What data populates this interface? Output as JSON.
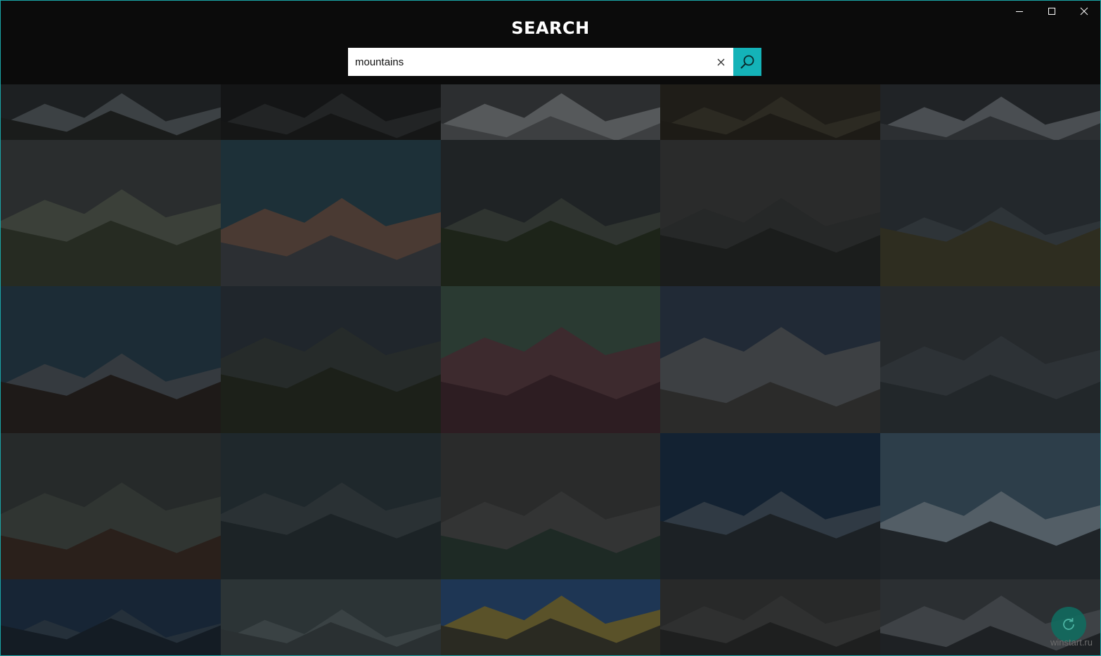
{
  "app": {
    "title": "SEARCH"
  },
  "window_controls": [
    "minimize-icon",
    "maximize-icon",
    "close-icon"
  ],
  "search": {
    "value": "mountains",
    "clear_icon": "close-icon",
    "button_icon": "search-icon"
  },
  "colors": {
    "accent": "#14b3b8",
    "background": "#0b0b0b",
    "border": "#1aa6a8",
    "fab": "#0f6e61"
  },
  "results": {
    "tiles": [
      {
        "sky": "#1d2022",
        "far": "#3c4144",
        "near": "#1a1c1b"
      },
      {
        "sky": "#141516",
        "far": "#222425",
        "near": "#151616"
      },
      {
        "sky": "#2c2e30",
        "far": "#56595b",
        "near": "#3d3f41"
      },
      {
        "sky": "#1f1d18",
        "far": "#2c2a22",
        "near": "#1d1b16"
      },
      {
        "sky": "#202326",
        "far": "#4a4e52",
        "near": "#2c2f32"
      },
      {
        "sky": "#2a2d2e",
        "far": "#3b4039",
        "near": "#262b22"
      },
      {
        "sky": "#1d3038",
        "far": "#4a3a33",
        "near": "#2c2f33"
      },
      {
        "sky": "#1f2325",
        "far": "#2f3430",
        "near": "#1d2419"
      },
      {
        "sky": "#2a2b2b",
        "far": "#262828",
        "near": "#1b1d1c"
      },
      {
        "sky": "#23282c",
        "far": "#2e3438",
        "near": "#2e2d20"
      },
      {
        "sky": "#1c2c36",
        "far": "#353a3f",
        "near": "#1e1a18"
      },
      {
        "sky": "#20262c",
        "far": "#262b2a",
        "near": "#1c2019"
      },
      {
        "sky": "#2a3a32",
        "far": "#3d2a2e",
        "near": "#2d1d22"
      },
      {
        "sky": "#212a36",
        "far": "#3d4043",
        "near": "#2b2b2a"
      },
      {
        "sky": "#262a2d",
        "far": "#2d3236",
        "near": "#22272a"
      },
      {
        "sky": "#262a2a",
        "far": "#303532",
        "near": "#2a201b"
      },
      {
        "sky": "#1f282c",
        "far": "#2a3134",
        "near": "#1c2326"
      },
      {
        "sky": "#2a2b2b",
        "far": "#333434",
        "near": "#1e2a25"
      },
      {
        "sky": "#132232",
        "far": "#303a44",
        "near": "#1c2125"
      },
      {
        "sky": "#2d3e4a",
        "far": "#535e66",
        "near": "#1f2428"
      },
      {
        "sky": "#172535",
        "far": "#25303a",
        "near": "#141c24"
      },
      {
        "sky": "#2c3436",
        "far": "#3a4244",
        "near": "#2a3032"
      },
      {
        "sky": "#1e3654",
        "far": "#5a5229",
        "near": "#2a2a22"
      },
      {
        "sky": "#282929",
        "far": "#2f3030",
        "near": "#1e1f1f"
      },
      {
        "sky": "#2b2f32",
        "far": "#3e4246",
        "near": "#1e2124"
      }
    ]
  },
  "fab": {
    "icon": "refresh-icon"
  },
  "watermark": "winstart.ru"
}
